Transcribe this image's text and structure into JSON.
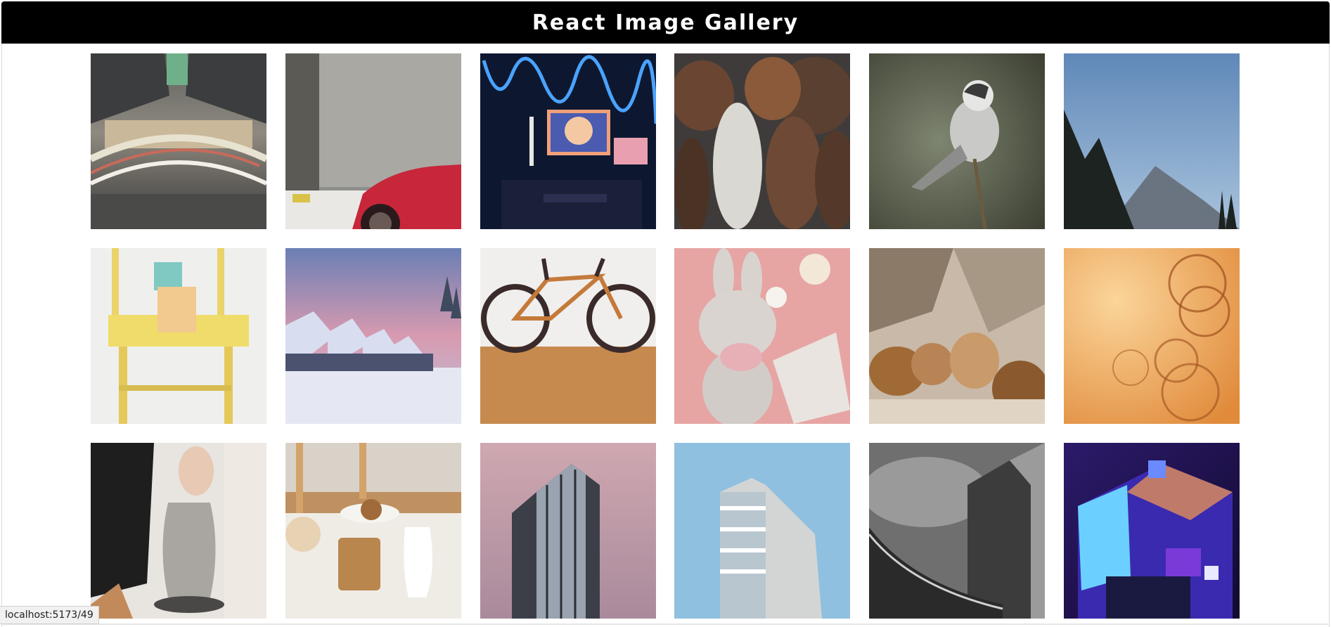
{
  "header": {
    "title": "React Image Gallery",
    "background_color": "#000000",
    "text_color": "#ffffff"
  },
  "gallery": {
    "columns": 6,
    "rows": 3,
    "images": [
      {
        "subject": "tunnel-light-trails"
      },
      {
        "subject": "red-car-in-garage"
      },
      {
        "subject": "neon-desk-setup"
      },
      {
        "subject": "herd-of-horses"
      },
      {
        "subject": "grey-jay-bird"
      },
      {
        "subject": "mountain-forest-sky"
      },
      {
        "subject": "yellow-chair-with-mugs"
      },
      {
        "subject": "snowy-cabins-sunset"
      },
      {
        "subject": "copper-fixie-bicycle"
      },
      {
        "subject": "plush-bunny-on-pink-cloth"
      },
      {
        "subject": "rocky-formations"
      },
      {
        "subject": "orange-bokeh-rings"
      },
      {
        "subject": "pottery-on-wheel"
      },
      {
        "subject": "coffee-and-cookies-table"
      },
      {
        "subject": "glass-skyscraper-pink-sky"
      },
      {
        "subject": "white-building-blue-sky"
      },
      {
        "subject": "black-and-white-towers"
      },
      {
        "subject": "abstract-3d-cubes"
      }
    ]
  },
  "status_bar": {
    "url": "localhost:5173/49"
  }
}
